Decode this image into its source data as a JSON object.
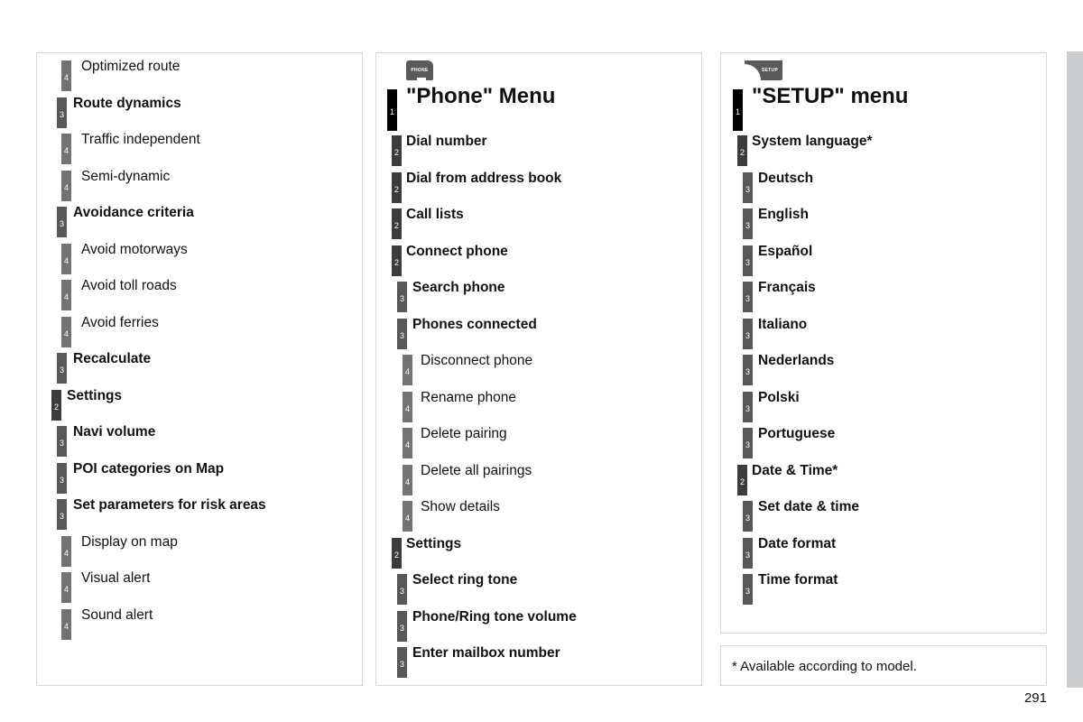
{
  "left_panel": {
    "items": [
      {
        "level": "4",
        "label": "Optimized route"
      },
      {
        "level": "3",
        "label": "Route dynamics"
      },
      {
        "level": "4",
        "label": "Traffic independent"
      },
      {
        "level": "4",
        "label": "Semi-dynamic"
      },
      {
        "level": "3",
        "label": "Avoidance criteria"
      },
      {
        "level": "4",
        "label": "Avoid motorways"
      },
      {
        "level": "4",
        "label": "Avoid toll roads"
      },
      {
        "level": "4",
        "label": "Avoid ferries"
      },
      {
        "level": "3",
        "label": "Recalculate"
      },
      {
        "level": "2",
        "label": "Settings"
      },
      {
        "level": "3",
        "label": "Navi volume"
      },
      {
        "level": "3",
        "label": "POI categories on Map"
      },
      {
        "level": "3",
        "label": "Set parameters for risk areas"
      },
      {
        "level": "4",
        "label": "Display on map"
      },
      {
        "level": "4",
        "label": "Visual alert"
      },
      {
        "level": "4",
        "label": "Sound alert"
      }
    ]
  },
  "phone_panel": {
    "icon_text": "PHONE",
    "title_level": "1",
    "title": "\"Phone\" Menu",
    "items": [
      {
        "level": "2",
        "label": "Dial number"
      },
      {
        "level": "2",
        "label": "Dial from address book"
      },
      {
        "level": "2",
        "label": "Call lists"
      },
      {
        "level": "2",
        "label": "Connect phone"
      },
      {
        "level": "3",
        "label": "Search phone"
      },
      {
        "level": "3",
        "label": "Phones connected"
      },
      {
        "level": "4",
        "label": "Disconnect phone"
      },
      {
        "level": "4",
        "label": "Rename phone"
      },
      {
        "level": "4",
        "label": "Delete pairing"
      },
      {
        "level": "4",
        "label": "Delete all pairings"
      },
      {
        "level": "4",
        "label": "Show details"
      },
      {
        "level": "2",
        "label": "Settings"
      },
      {
        "level": "3",
        "label": "Select ring tone"
      },
      {
        "level": "3",
        "label": "Phone/Ring tone volume"
      },
      {
        "level": "3",
        "label": "Enter mailbox number"
      }
    ]
  },
  "setup_panel": {
    "icon_text": "SETUP",
    "title_level": "1",
    "title": "\"SETUP\" menu",
    "items": [
      {
        "level": "2",
        "label": "System language*"
      },
      {
        "level": "3",
        "label": "Deutsch"
      },
      {
        "level": "3",
        "label": "English"
      },
      {
        "level": "3",
        "label": "Español"
      },
      {
        "level": "3",
        "label": "Français"
      },
      {
        "level": "3",
        "label": "Italiano"
      },
      {
        "level": "3",
        "label": "Nederlands"
      },
      {
        "level": "3",
        "label": "Polski"
      },
      {
        "level": "3",
        "label": "Portuguese"
      },
      {
        "level": "2",
        "label": "Date & Time*"
      },
      {
        "level": "3",
        "label": "Set date & time"
      },
      {
        "level": "3",
        "label": "Date format"
      },
      {
        "level": "3",
        "label": "Time format"
      }
    ]
  },
  "footnote": "* Available according to model.",
  "page_number": "291"
}
